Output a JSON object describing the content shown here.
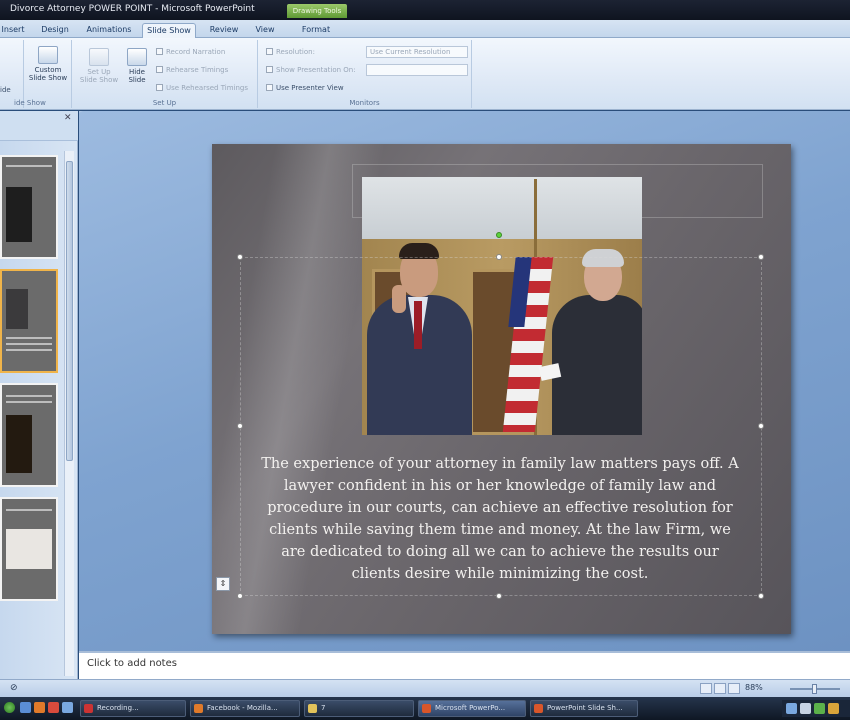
{
  "window": {
    "title": "Divorce Attorney  POWER POINT - Microsoft PowerPoint",
    "contextual_tab": "Drawing Tools"
  },
  "ribbon": {
    "tabs": [
      {
        "label": "Insert"
      },
      {
        "label": "Design"
      },
      {
        "label": "Animations"
      },
      {
        "label": "Slide Show",
        "active": true
      },
      {
        "label": "Review"
      },
      {
        "label": "View"
      },
      {
        "label": "Format"
      }
    ],
    "start_group": {
      "label": "Start Slide Show",
      "partial_label": "ide"
    },
    "custom_show": {
      "label": "Custom Slide Show"
    },
    "setup": {
      "label": "Set Up",
      "setup_show": "Set Up Slide Show",
      "hide_slide": "Hide Slide",
      "record_narration": "Record Narration",
      "rehearse_timings": "Rehearse Timings",
      "use_rehearsed_timings": "Use Rehearsed Timings"
    },
    "monitors": {
      "label": "Monitors",
      "resolution_label": "Resolution:",
      "show_presentation_on": "Show Presentation On:",
      "resolution_value": "Use Current Resolution",
      "presenter_view": "Use Presenter View"
    }
  },
  "slide": {
    "body_text": "The experience of your attorney in family law matters pays off. A lawyer confident in his or her knowledge of family law and procedure in our courts, can achieve an effective resolution for clients while saving them time and money. At the law Firm, we are dedicated to doing all we can to achieve the results our clients desire while minimizing the cost."
  },
  "notes": {
    "placeholder": "Click to add notes"
  },
  "status": {
    "zoom": "88%"
  },
  "taskbar": {
    "items": [
      {
        "label": "Recording..."
      },
      {
        "label": "Facebook - Mozilla..."
      },
      {
        "label": "7"
      },
      {
        "label": "Microsoft PowerPo..."
      },
      {
        "label": "PowerPoint Slide Sh..."
      }
    ]
  },
  "colors": {
    "canvas": "#7fa3d0",
    "slide_bg": "#6a666b",
    "selected_thumb": "#f0b44a",
    "contextual_tab": "#5f9a35"
  }
}
